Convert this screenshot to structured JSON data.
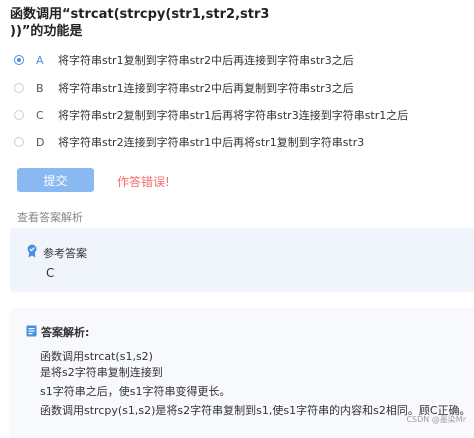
{
  "question": {
    "line1": "函数调用“strcat(strcpy(str1,str2,str3",
    "line2": "))”的功能是"
  },
  "options": [
    {
      "letter": "A",
      "text": "将字符串str1复制到字符串str2中后再连接到字符串str3之后",
      "selected": true
    },
    {
      "letter": "B",
      "text": "将字符串str1连接到字符串str2中后再复制到字符串str3之后",
      "selected": false
    },
    {
      "letter": "C",
      "text": "将字符串str2复制到字符串str1后再将字符串str3连接到字符串str1之后",
      "selected": false
    },
    {
      "letter": "D",
      "text": "将字符串str2连接到字符串str1中后再将str1复制到字符串str3",
      "selected": false
    }
  ],
  "actions": {
    "submit_label": "提交",
    "result_text": "作答错误!"
  },
  "analysis_link": "查看答案解析",
  "reference": {
    "title": "参考答案",
    "answer": "C"
  },
  "explanation": {
    "title": "答案解析:",
    "lines": [
      "函数调用strcat(s1,s2)",
      "是将s2字符串复制连接到",
      "s1字符串之后，使s1字符串变得更长。",
      "函数调用strcpy(s1,s2)是将s2字符串复制到s1,使s1字符串的内容和s2相同。顾C正确。"
    ]
  },
  "watermark": "CSDN @墨染Mr",
  "colors": {
    "accent": "#4a90e2",
    "submit_bg": "#8ab8f0",
    "error": "#f56c6c",
    "ref_bg": "#f0f5fc"
  }
}
